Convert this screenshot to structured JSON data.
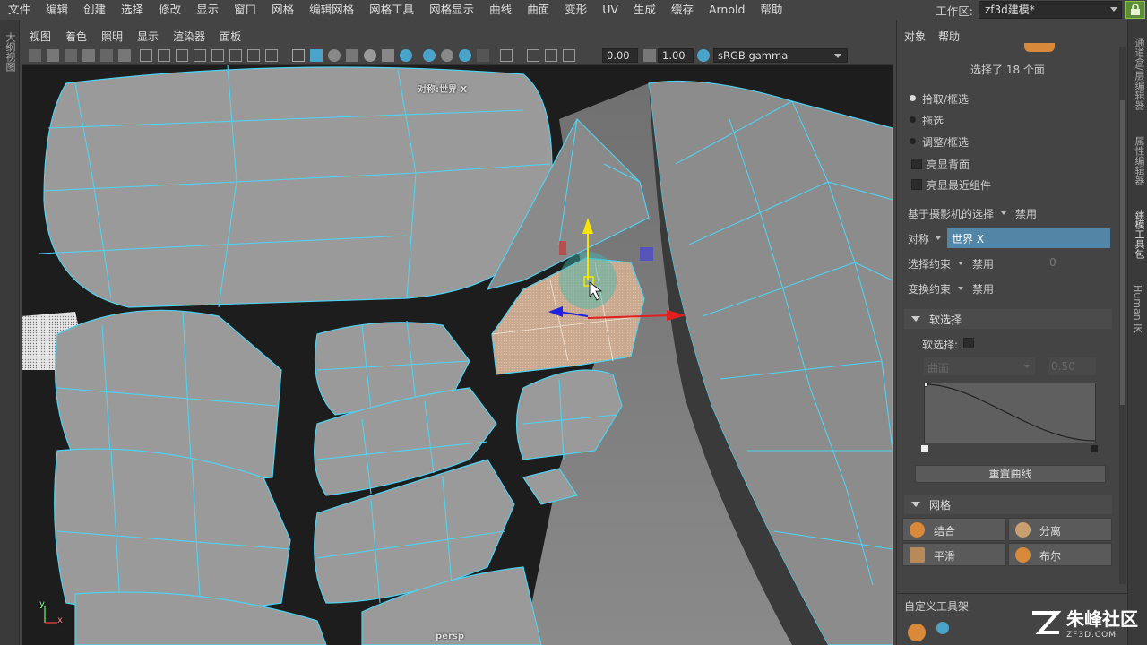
{
  "menubar": {
    "items": [
      "文件",
      "编辑",
      "创建",
      "选择",
      "修改",
      "显示",
      "窗口",
      "网格",
      "编辑网格",
      "网格工具",
      "网格显示",
      "曲线",
      "曲面",
      "变形",
      "UV",
      "生成",
      "缓存",
      "Arnold",
      "帮助"
    ],
    "workspace_label": "工作区:",
    "workspace_value": "zf3d建模*"
  },
  "left_strip": {
    "tab": "大纲视图"
  },
  "panel_menu": {
    "items": [
      "视图",
      "着色",
      "照明",
      "显示",
      "渲染器",
      "面板"
    ]
  },
  "viewport_toolbar": {
    "value_a": "0.00",
    "value_b": "1.00",
    "color_space": "sRGB gamma"
  },
  "viewport": {
    "symmetry_label": "对称:世界 X",
    "camera_label": "persp",
    "axis_y": "y",
    "axis_x": "x"
  },
  "right_panel": {
    "menu": [
      "对象",
      "帮助"
    ],
    "selection_info": "选择了 18 个面",
    "options": [
      {
        "label": "拾取/框选",
        "selected": true
      },
      {
        "label": "拖选",
        "selected": false
      },
      {
        "label": "调整/框选",
        "selected": false
      }
    ],
    "checks": [
      "亮显背面",
      "亮显最近组件"
    ],
    "camera_selection_label": "基于摄影机的选择",
    "camera_selection_value": "禁用",
    "symmetry_label": "对称",
    "symmetry_value": "世界 X",
    "select_constraint_label": "选择约束",
    "select_constraint_value": "禁用",
    "select_constraint_num": "0",
    "transform_constraint_label": "变换约束",
    "transform_constraint_value": "禁用",
    "soft_select_section": "软选择",
    "soft_select_label": "软选择:",
    "falloff_mode": "曲面",
    "falloff_value": "0.50",
    "reset_curve": "重置曲线",
    "mesh_section": "网格",
    "mesh_tools": [
      {
        "label": "结合",
        "icon": "combine-icon"
      },
      {
        "label": "分离",
        "icon": "separate-icon"
      },
      {
        "label": "平滑",
        "icon": "smooth-icon"
      },
      {
        "label": "布尔",
        "icon": "boolean-icon"
      }
    ],
    "custom_shelf": "自定义工具架"
  },
  "right_strip": {
    "tabs": [
      "通道盒/层编辑器",
      "属性编辑器",
      "建模工具包",
      "Human IK"
    ]
  },
  "watermark": {
    "brand": "朱峰社区",
    "url": "ZF3D.COM"
  }
}
